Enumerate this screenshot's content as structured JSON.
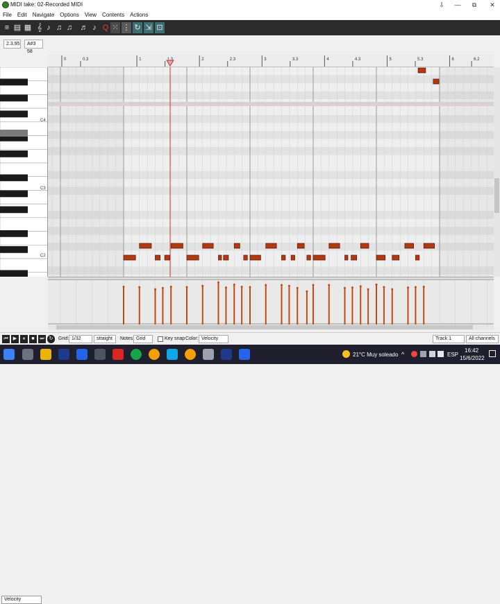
{
  "window": {
    "title": "MIDI take: 02-Recorded MIDI",
    "minimize": "—",
    "restore": "⧉",
    "close": "✕",
    "pin": "⇩"
  },
  "menu": [
    "File",
    "Edit",
    "Navigate",
    "Options",
    "View",
    "Contents",
    "Actions"
  ],
  "toolbar_icons": [
    "list-view-icon",
    "piano-view-icon",
    "grid-view-icon",
    "key-icon",
    "quantize-icon",
    "quantize-start-icon",
    "quantize-end-icon",
    "note-lock-icon",
    "humanize-icon",
    "quantize-q-icon",
    "dot-grid-icon",
    "snap-icon",
    "loop-icon",
    "chase-icon"
  ],
  "info": {
    "position": "2.3.95",
    "note": "A#3 58"
  },
  "ruler": {
    "marks": [
      "0",
      "0.3",
      "1",
      "1.3",
      "2",
      "2.3",
      "3",
      "3.3",
      "4",
      "4.3",
      "5",
      "5.3",
      "6",
      "6.2"
    ]
  },
  "piano": {
    "octave_labels": [
      "C4",
      "C3",
      "C2"
    ]
  },
  "notes": [
    {
      "beat": 0.0,
      "len": 0.2,
      "row": 0
    },
    {
      "beat": 0.25,
      "len": 0.2,
      "row": 1
    },
    {
      "beat": 0.5,
      "len": 0.09,
      "row": 0
    },
    {
      "beat": 0.65,
      "len": 0.09,
      "row": 0
    },
    {
      "beat": 0.75,
      "len": 0.2,
      "row": 1
    },
    {
      "beat": 1.0,
      "len": 0.2,
      "row": 0
    },
    {
      "beat": 1.25,
      "len": 0.18,
      "row": 1
    },
    {
      "beat": 1.5,
      "len": 0.06,
      "row": 0
    },
    {
      "beat": 1.58,
      "len": 0.09,
      "row": 0
    },
    {
      "beat": 1.75,
      "len": 0.1,
      "row": 1
    },
    {
      "beat": 1.9,
      "len": 0.07,
      "row": 0
    },
    {
      "beat": 2.0,
      "len": 0.18,
      "row": 0
    },
    {
      "beat": 2.25,
      "len": 0.18,
      "row": 1
    },
    {
      "beat": 2.5,
      "len": 0.07,
      "row": 0
    },
    {
      "beat": 2.65,
      "len": 0.07,
      "row": 0
    },
    {
      "beat": 2.75,
      "len": 0.12,
      "row": 1
    },
    {
      "beat": 2.9,
      "len": 0.07,
      "row": 0
    },
    {
      "beat": 3.0,
      "len": 0.2,
      "row": 0
    },
    {
      "beat": 3.25,
      "len": 0.18,
      "row": 1
    },
    {
      "beat": 3.5,
      "len": 0.06,
      "row": 0
    },
    {
      "beat": 3.6,
      "len": 0.1,
      "row": 0
    },
    {
      "beat": 3.75,
      "len": 0.14,
      "row": 1
    },
    {
      "beat": 4.0,
      "len": 0.15,
      "row": 0
    },
    {
      "beat": 4.25,
      "len": 0.12,
      "row": 0
    },
    {
      "beat": 4.45,
      "len": 0.15,
      "row": 1
    },
    {
      "beat": 4.62,
      "len": 0.07,
      "row": 0
    },
    {
      "beat": 4.75,
      "len": 0.18,
      "row": 1
    },
    {
      "beat": 4.66,
      "len": 0.13,
      "row": 2
    },
    {
      "beat": 4.9,
      "len": 0.1,
      "row": 3
    }
  ],
  "velocities": [
    {
      "beat": 0.0,
      "v": 0.88
    },
    {
      "beat": 0.25,
      "v": 0.87
    },
    {
      "beat": 0.5,
      "v": 0.82
    },
    {
      "beat": 0.62,
      "v": 0.85
    },
    {
      "beat": 0.75,
      "v": 0.88
    },
    {
      "beat": 1.0,
      "v": 0.87
    },
    {
      "beat": 1.25,
      "v": 0.9
    },
    {
      "beat": 1.5,
      "v": 0.98
    },
    {
      "beat": 1.62,
      "v": 0.86
    },
    {
      "beat": 1.75,
      "v": 0.93
    },
    {
      "beat": 1.87,
      "v": 0.88
    },
    {
      "beat": 2.0,
      "v": 0.87
    },
    {
      "beat": 2.25,
      "v": 0.92
    },
    {
      "beat": 2.5,
      "v": 0.92
    },
    {
      "beat": 2.62,
      "v": 0.9
    },
    {
      "beat": 2.75,
      "v": 0.85
    },
    {
      "beat": 2.9,
      "v": 0.77
    },
    {
      "beat": 3.0,
      "v": 0.92
    },
    {
      "beat": 3.25,
      "v": 0.92
    },
    {
      "beat": 3.5,
      "v": 0.85
    },
    {
      "beat": 3.62,
      "v": 0.86
    },
    {
      "beat": 3.75,
      "v": 0.89
    },
    {
      "beat": 3.87,
      "v": 0.82
    },
    {
      "beat": 4.0,
      "v": 0.93
    },
    {
      "beat": 4.12,
      "v": 0.87
    },
    {
      "beat": 4.25,
      "v": 0.82
    },
    {
      "beat": 4.5,
      "v": 0.86
    },
    {
      "beat": 4.62,
      "v": 0.87
    },
    {
      "beat": 4.75,
      "v": 0.88
    }
  ],
  "velocity_lane": "Velocity",
  "bottom": {
    "grid_label": "Grid:",
    "grid_value": "1/32",
    "swing_value": "straight",
    "notes_label": "Notes:",
    "notes_value": "Grid",
    "keysnap_label": "Key snap",
    "color_label": "Color:",
    "color_value": "Velocity",
    "track_value": "Track 1",
    "channels_value": "All channels"
  },
  "taskbar": {
    "weather": "21°C  Muy soleado",
    "lang": "ESP",
    "time": "16:42",
    "date": "15/6/2022"
  },
  "colors": {
    "note": "#b03a14",
    "note_border": "#5a1000",
    "stem": "#c14a14",
    "toolbar": "#2b2b2b",
    "playhead": "#c0392b"
  }
}
